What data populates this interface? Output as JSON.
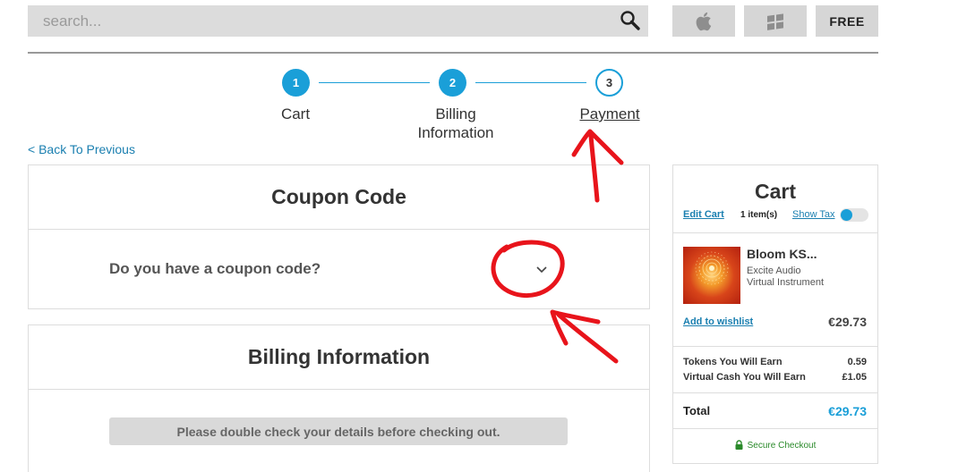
{
  "search": {
    "placeholder": "search..."
  },
  "platforms": {
    "free_label": "FREE",
    "mac_icon": "apple-icon",
    "windows_icon": "windows-icon"
  },
  "steps": [
    {
      "number": "1",
      "label": "Cart"
    },
    {
      "number": "2",
      "label": "Billing\nInformation"
    },
    {
      "number": "3",
      "label": "Payment"
    }
  ],
  "back_link": "< Back To Previous",
  "coupon": {
    "title": "Coupon Code",
    "question": "Do you have a coupon code?"
  },
  "billing": {
    "title": "Billing Information",
    "notice": "Please double check your details before checking out."
  },
  "cart": {
    "title": "Cart",
    "edit_label": "Edit Cart",
    "item_count": "1 item(s)",
    "show_tax_label": "Show Tax",
    "product": {
      "name": "Bloom KS...",
      "maker": "Excite Audio",
      "type": "Virtual Instrument",
      "wishlist_label": "Add to wishlist",
      "price": "€29.73"
    },
    "tokens_label": "Tokens You Will Earn",
    "tokens_value": "0.59",
    "cash_label": "Virtual Cash You Will Earn",
    "cash_value": "£1.05",
    "total_label": "Total",
    "total_value": "€29.73",
    "secure_label": "Secure Checkout"
  },
  "colors": {
    "accent": "#1a9fd8",
    "link": "#1a7fb0",
    "annotation": "#e8141b",
    "secure": "#2a8a2a"
  }
}
